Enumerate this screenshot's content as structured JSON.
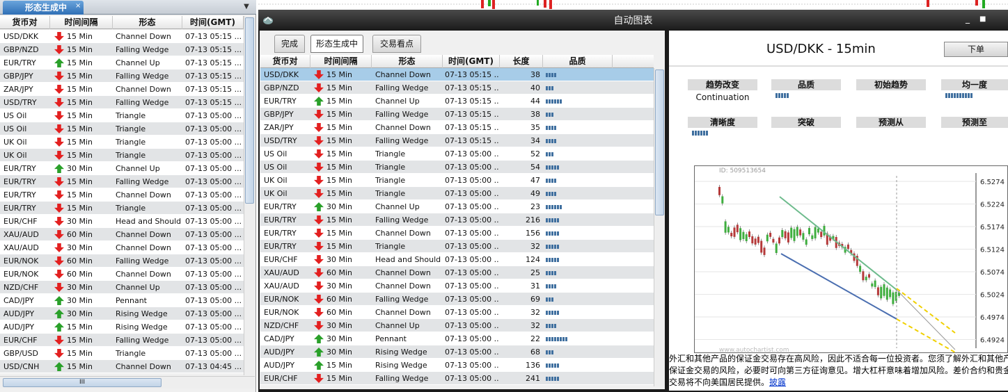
{
  "left": {
    "tab_label": "形态生成中",
    "close_glyph": "×",
    "dropdown_glyph": "▼",
    "headers": [
      "货币对",
      "时间间隔",
      "形态",
      "时间(GMT)"
    ],
    "rows": [
      {
        "pair": "USD/DKK",
        "dir": "down",
        "interval": "15 Min",
        "pattern": "Channel Down",
        "time": "07-13 05:15 ..."
      },
      {
        "pair": "GBP/NZD",
        "dir": "down",
        "interval": "15 Min",
        "pattern": "Falling Wedge",
        "time": "07-13 05:15 ..."
      },
      {
        "pair": "EUR/TRY",
        "dir": "up",
        "interval": "15 Min",
        "pattern": "Channel Up",
        "time": "07-13 05:15 ..."
      },
      {
        "pair": "GBP/JPY",
        "dir": "down",
        "interval": "15 Min",
        "pattern": "Falling Wedge",
        "time": "07-13 05:15 ..."
      },
      {
        "pair": "ZAR/JPY",
        "dir": "down",
        "interval": "15 Min",
        "pattern": "Channel Down",
        "time": "07-13 05:15 ..."
      },
      {
        "pair": "USD/TRY",
        "dir": "down",
        "interval": "15 Min",
        "pattern": "Falling Wedge",
        "time": "07-13 05:15 ..."
      },
      {
        "pair": "US Oil",
        "dir": "down",
        "interval": "15 Min",
        "pattern": "Triangle",
        "time": "07-13 05:00 ..."
      },
      {
        "pair": "US Oil",
        "dir": "down",
        "interval": "15 Min",
        "pattern": "Triangle",
        "time": "07-13 05:00 ..."
      },
      {
        "pair": "UK Oil",
        "dir": "down",
        "interval": "15 Min",
        "pattern": "Triangle",
        "time": "07-13 05:00 ..."
      },
      {
        "pair": "UK Oil",
        "dir": "down",
        "interval": "15 Min",
        "pattern": "Triangle",
        "time": "07-13 05:00 ..."
      },
      {
        "pair": "EUR/TRY",
        "dir": "up",
        "interval": "30 Min",
        "pattern": "Channel Up",
        "time": "07-13 05:00 ..."
      },
      {
        "pair": "EUR/TRY",
        "dir": "down",
        "interval": "15 Min",
        "pattern": "Falling Wedge",
        "time": "07-13 05:00 ..."
      },
      {
        "pair": "EUR/TRY",
        "dir": "down",
        "interval": "15 Min",
        "pattern": "Channel Down",
        "time": "07-13 05:00 ..."
      },
      {
        "pair": "EUR/TRY",
        "dir": "down",
        "interval": "15 Min",
        "pattern": "Triangle",
        "time": "07-13 05:00 ..."
      },
      {
        "pair": "EUR/CHF",
        "dir": "down",
        "interval": "30 Min",
        "pattern": "Head and Should...",
        "time": "07-13 05:00 ..."
      },
      {
        "pair": "XAU/AUD",
        "dir": "down",
        "interval": "60 Min",
        "pattern": "Channel Down",
        "time": "07-13 05:00 ..."
      },
      {
        "pair": "XAU/AUD",
        "dir": "down",
        "interval": "30 Min",
        "pattern": "Channel Down",
        "time": "07-13 05:00 ..."
      },
      {
        "pair": "EUR/NOK",
        "dir": "down",
        "interval": "60 Min",
        "pattern": "Falling Wedge",
        "time": "07-13 05:00 ..."
      },
      {
        "pair": "EUR/NOK",
        "dir": "down",
        "interval": "60 Min",
        "pattern": "Channel Down",
        "time": "07-13 05:00 ..."
      },
      {
        "pair": "NZD/CHF",
        "dir": "down",
        "interval": "30 Min",
        "pattern": "Channel Up",
        "time": "07-13 05:00 ..."
      },
      {
        "pair": "CAD/JPY",
        "dir": "up",
        "interval": "30 Min",
        "pattern": "Pennant",
        "time": "07-13 05:00 ..."
      },
      {
        "pair": "AUD/JPY",
        "dir": "up",
        "interval": "30 Min",
        "pattern": "Rising Wedge",
        "time": "07-13 05:00 ..."
      },
      {
        "pair": "AUD/JPY",
        "dir": "up",
        "interval": "15 Min",
        "pattern": "Rising Wedge",
        "time": "07-13 05:00 ..."
      },
      {
        "pair": "EUR/CHF",
        "dir": "down",
        "interval": "15 Min",
        "pattern": "Falling Wedge",
        "time": "07-13 05:00 ..."
      },
      {
        "pair": "GBP/USD",
        "dir": "down",
        "interval": "15 Min",
        "pattern": "Triangle",
        "time": "07-13 05:00 ..."
      },
      {
        "pair": "USD/CNH",
        "dir": "up",
        "interval": "15 Min",
        "pattern": "Channel Down",
        "time": "07-13 04:45 ..."
      }
    ],
    "hscroll_grip": "III"
  },
  "window": {
    "title": "自动图表",
    "minimize_glyph": "_",
    "restore_glyph": "■"
  },
  "middle": {
    "tabs": [
      "完成",
      "形态生成中",
      "交易看点"
    ],
    "headers": [
      "货币对",
      "时间间隔",
      "形态",
      "时间(GMT)",
      "长度",
      "品质"
    ],
    "rows": [
      {
        "pair": "USD/DKK",
        "dir": "down",
        "interval": "15 Min",
        "pattern": "Channel Down",
        "time": "07-13 05:15 ...",
        "length": "38",
        "quality": 4
      },
      {
        "pair": "GBP/NZD",
        "dir": "down",
        "interval": "15 Min",
        "pattern": "Falling Wedge",
        "time": "07-13 05:15 ...",
        "length": "40",
        "quality": 3
      },
      {
        "pair": "EUR/TRY",
        "dir": "up",
        "interval": "15 Min",
        "pattern": "Channel Up",
        "time": "07-13 05:15 ...",
        "length": "44",
        "quality": 6
      },
      {
        "pair": "GBP/JPY",
        "dir": "down",
        "interval": "15 Min",
        "pattern": "Falling Wedge",
        "time": "07-13 05:15 ...",
        "length": "38",
        "quality": 3
      },
      {
        "pair": "ZAR/JPY",
        "dir": "down",
        "interval": "15 Min",
        "pattern": "Channel Down",
        "time": "07-13 05:15 ...",
        "length": "35",
        "quality": 4
      },
      {
        "pair": "USD/TRY",
        "dir": "down",
        "interval": "15 Min",
        "pattern": "Falling Wedge",
        "time": "07-13 05:15 ...",
        "length": "34",
        "quality": 4
      },
      {
        "pair": "US Oil",
        "dir": "down",
        "interval": "15 Min",
        "pattern": "Triangle",
        "time": "07-13 05:00 ...",
        "length": "52",
        "quality": 3
      },
      {
        "pair": "US Oil",
        "dir": "down",
        "interval": "15 Min",
        "pattern": "Triangle",
        "time": "07-13 05:00 ...",
        "length": "54",
        "quality": 5
      },
      {
        "pair": "UK Oil",
        "dir": "down",
        "interval": "15 Min",
        "pattern": "Triangle",
        "time": "07-13 05:00 ...",
        "length": "47",
        "quality": 4
      },
      {
        "pair": "UK Oil",
        "dir": "down",
        "interval": "15 Min",
        "pattern": "Triangle",
        "time": "07-13 05:00 ...",
        "length": "49",
        "quality": 4
      },
      {
        "pair": "EUR/TRY",
        "dir": "up",
        "interval": "30 Min",
        "pattern": "Channel Up",
        "time": "07-13 05:00 ...",
        "length": "23",
        "quality": 6
      },
      {
        "pair": "EUR/TRY",
        "dir": "down",
        "interval": "15 Min",
        "pattern": "Falling Wedge",
        "time": "07-13 05:00 ...",
        "length": "216",
        "quality": 5
      },
      {
        "pair": "EUR/TRY",
        "dir": "down",
        "interval": "15 Min",
        "pattern": "Channel Down",
        "time": "07-13 05:00 ...",
        "length": "156",
        "quality": 5
      },
      {
        "pair": "EUR/TRY",
        "dir": "down",
        "interval": "15 Min",
        "pattern": "Triangle",
        "time": "07-13 05:00 ...",
        "length": "32",
        "quality": 5
      },
      {
        "pair": "EUR/CHF",
        "dir": "down",
        "interval": "30 Min",
        "pattern": "Head and Should...",
        "time": "07-13 05:00 ...",
        "length": "124",
        "quality": 5
      },
      {
        "pair": "XAU/AUD",
        "dir": "down",
        "interval": "60 Min",
        "pattern": "Channel Down",
        "time": "07-13 05:00 ...",
        "length": "25",
        "quality": 4
      },
      {
        "pair": "XAU/AUD",
        "dir": "down",
        "interval": "30 Min",
        "pattern": "Channel Down",
        "time": "07-13 05:00 ...",
        "length": "31",
        "quality": 4
      },
      {
        "pair": "EUR/NOK",
        "dir": "down",
        "interval": "60 Min",
        "pattern": "Falling Wedge",
        "time": "07-13 05:00 ...",
        "length": "69",
        "quality": 3
      },
      {
        "pair": "EUR/NOK",
        "dir": "down",
        "interval": "60 Min",
        "pattern": "Channel Down",
        "time": "07-13 05:00 ...",
        "length": "32",
        "quality": 5
      },
      {
        "pair": "NZD/CHF",
        "dir": "down",
        "interval": "30 Min",
        "pattern": "Channel Up",
        "time": "07-13 05:00 ...",
        "length": "32",
        "quality": 4
      },
      {
        "pair": "CAD/JPY",
        "dir": "up",
        "interval": "30 Min",
        "pattern": "Pennant",
        "time": "07-13 05:00 ...",
        "length": "22",
        "quality": 8
      },
      {
        "pair": "AUD/JPY",
        "dir": "up",
        "interval": "30 Min",
        "pattern": "Rising Wedge",
        "time": "07-13 05:00 ...",
        "length": "68",
        "quality": 3
      },
      {
        "pair": "AUD/JPY",
        "dir": "up",
        "interval": "15 Min",
        "pattern": "Rising Wedge",
        "time": "07-13 05:00 ...",
        "length": "136",
        "quality": 5
      },
      {
        "pair": "EUR/CHF",
        "dir": "down",
        "interval": "15 Min",
        "pattern": "Falling Wedge",
        "time": "07-13 05:00 ...",
        "length": "241",
        "quality": 5
      }
    ]
  },
  "detail": {
    "title": "USD/DKK - 15min",
    "order_button": "下单",
    "stats": [
      {
        "label": "趋势改变",
        "value": "Continuation",
        "bars": 0
      },
      {
        "label": "品质",
        "value": "",
        "bars": 5
      },
      {
        "label": "初始趋势",
        "value": "",
        "bars": 0
      },
      {
        "label": "均一度",
        "value": "",
        "bars": 10
      },
      {
        "label": "清晰度",
        "value": "",
        "bars": 6
      },
      {
        "label": "突破",
        "value": "",
        "bars": 0
      },
      {
        "label": "预测从",
        "value": "",
        "bars": 0
      },
      {
        "label": "预测至",
        "value": "",
        "bars": 0
      }
    ],
    "chart": {
      "id_label": "ID: 509513654",
      "watermark": "www.autochartist.com",
      "price_ticks": [
        "6.5274",
        "6.5224",
        "6.5174",
        "6.5124",
        "6.5074",
        "6.5024",
        "6.4974",
        "6.4924"
      ]
    },
    "disclaimer_line1": "外汇和其他产品的保证金交易存在高风险，因此不适合每一位投资者。您须了解外汇和其他产",
    "disclaimer_line2": "保证金交易的风险，必要时可向第三方征询意见。增大杠杆意味着增加风险。差价合约和贵金",
    "disclaimer_line3": "交易将不向美国居民提供。",
    "disclaimer_link": "披露"
  },
  "colors": {
    "down": "#e32020",
    "up": "#2aa02a",
    "selected": "#a7cce8",
    "quality": "#3f6f9f"
  }
}
